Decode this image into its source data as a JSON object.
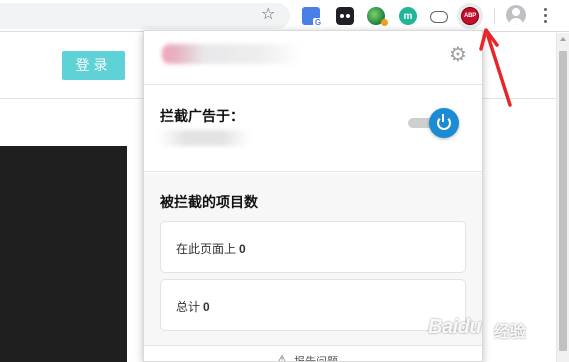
{
  "page": {
    "login_label": "登录"
  },
  "toolbar": {
    "extensions": [
      "translate-extension-icon",
      "dots-extension-icon",
      "globe-extension-icon",
      "m-extension-icon",
      "cloud-extension-icon",
      "adblock-plus-icon"
    ],
    "m_ext_label": "m",
    "abp_label": "ABP"
  },
  "popup": {
    "block_ads_label": "拦截广告于：",
    "blocked_count_title": "被拦截的项目数",
    "stats": [
      {
        "label": "在此页面上",
        "value": "0"
      },
      {
        "label": "总计",
        "value": "0"
      }
    ],
    "report_label": "报告问题",
    "toggle_state": "on",
    "accent_color": "#1b8bd4"
  },
  "watermark": {
    "text": "Baidu",
    "sub": "经验"
  }
}
